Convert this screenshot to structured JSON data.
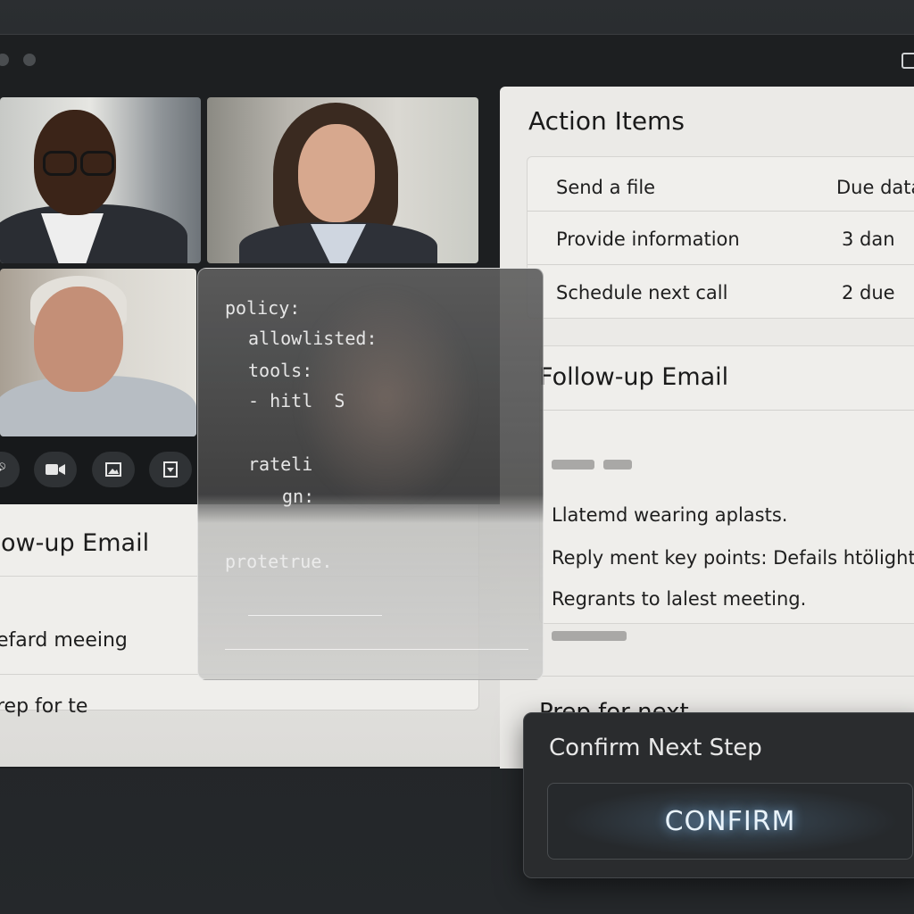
{
  "left_panel": {
    "title": "llow-up Email",
    "rows": [
      "efard meeing",
      "rep for te"
    ]
  },
  "action_items": {
    "title": "Action Items",
    "rows": [
      {
        "task": "Send a file",
        "due": "Due data"
      },
      {
        "task": "Provide information",
        "due": "3 dan"
      },
      {
        "task": "Schedule next call",
        "due": "2 due"
      }
    ]
  },
  "followup_email": {
    "title": "Follow-up Email",
    "lines": [
      "Llatemd wearing aplasts.",
      "Reply ment key points: Defails htölight.",
      "Regrants to lalest meeting."
    ]
  },
  "prep": {
    "title": "Prep for next"
  },
  "policy": {
    "lines": [
      "policy:",
      "allowlisted:",
      "tools:",
      "- hitl  S",
      "rateli",
      "gn:"
    ],
    "footer": "protetrue."
  },
  "dialog": {
    "title": "Confirm Next Step",
    "button": "CONFIRM"
  },
  "icons": {
    "controls": [
      "mic-icon",
      "camera-icon",
      "image-icon",
      "download-icon"
    ]
  }
}
